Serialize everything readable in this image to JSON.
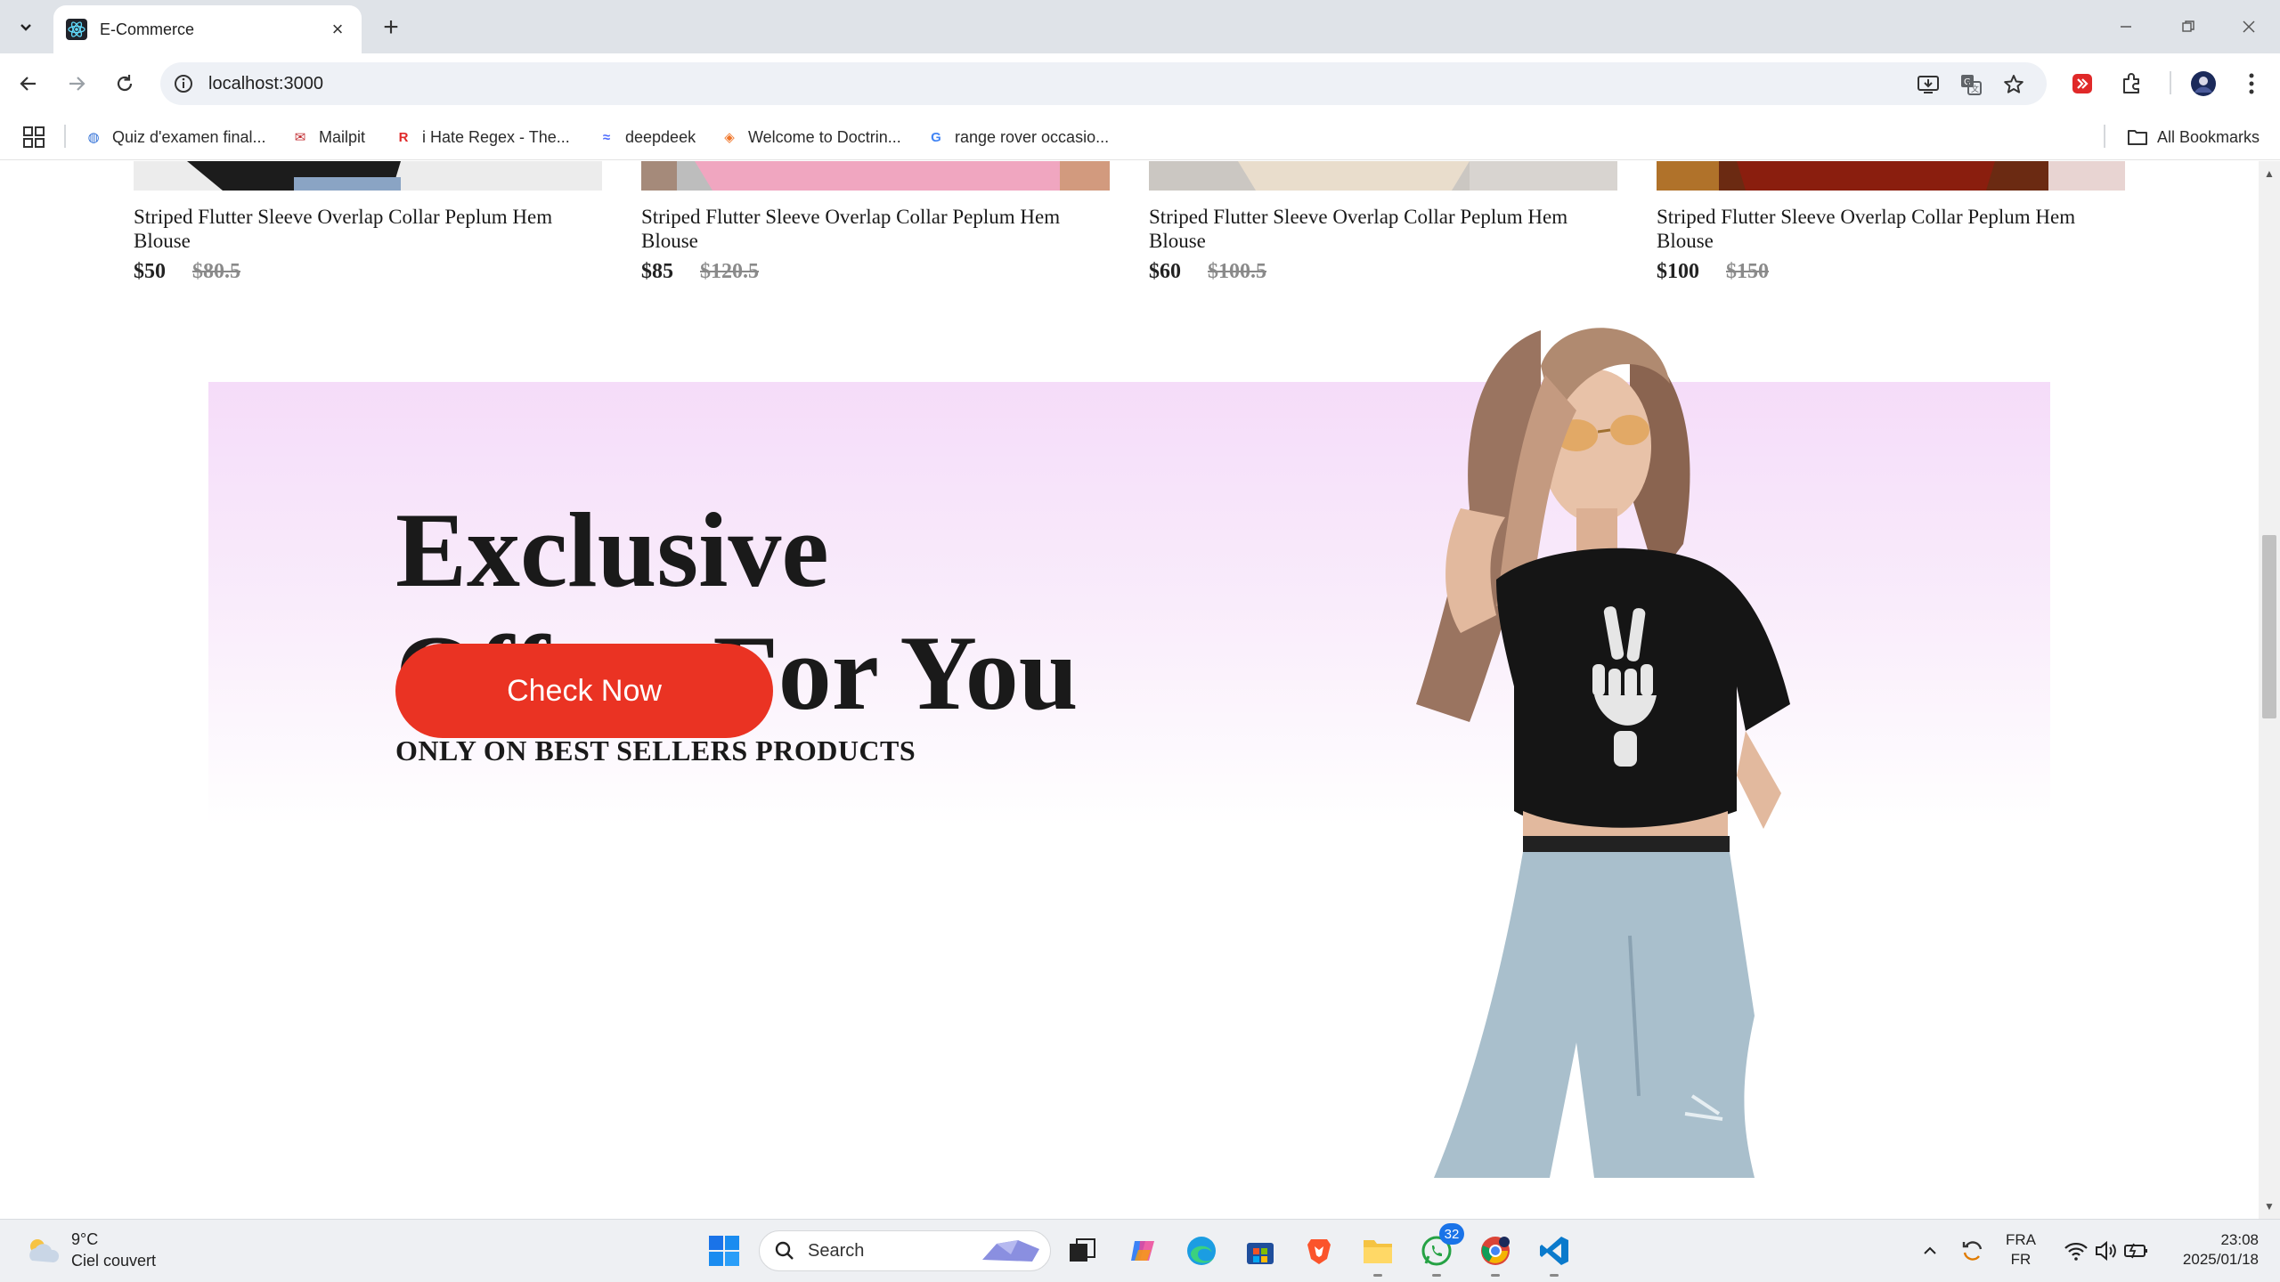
{
  "browser": {
    "tab_title": "E-Commerce",
    "url": "localhost:3000",
    "bookmarks": [
      {
        "label": "Quiz d'examen final...",
        "icon": "quiz-icon"
      },
      {
        "label": "Mailpit",
        "icon": "mailpit-icon"
      },
      {
        "label": "i Hate Regex - The...",
        "icon": "regex-icon"
      },
      {
        "label": "deepdeek",
        "icon": "deepseek-icon"
      },
      {
        "label": "Welcome to Doctrin...",
        "icon": "doctrine-icon"
      },
      {
        "label": "range rover occasio...",
        "icon": "google-icon"
      }
    ],
    "all_bookmarks_label": "All Bookmarks"
  },
  "products": [
    {
      "name": "Striped Flutter Sleeve Overlap Collar Peplum Hem Blouse",
      "price": "$50",
      "old_price": "$80.5"
    },
    {
      "name": "Striped Flutter Sleeve Overlap Collar Peplum Hem Blouse",
      "price": "$85",
      "old_price": "$120.5"
    },
    {
      "name": "Striped Flutter Sleeve Overlap Collar Peplum Hem Blouse",
      "price": "$60",
      "old_price": "$100.5"
    },
    {
      "name": "Striped Flutter Sleeve Overlap Collar Peplum Hem Blouse",
      "price": "$100",
      "old_price": "$150"
    }
  ],
  "hero": {
    "title_line1": "Exclusive",
    "title_line2": "Offers For You",
    "subtitle": "ONLY ON BEST SELLERS PRODUCTS",
    "button_label": "Check Now",
    "accent_color": "#ea3323"
  },
  "taskbar": {
    "temperature": "9°C",
    "weather_desc": "Ciel couvert",
    "search_placeholder": "Search",
    "whatsapp_badge": "32",
    "lang_top": "FRA",
    "lang_bottom": "FR",
    "time": "23:08",
    "date": "2025/01/18"
  }
}
